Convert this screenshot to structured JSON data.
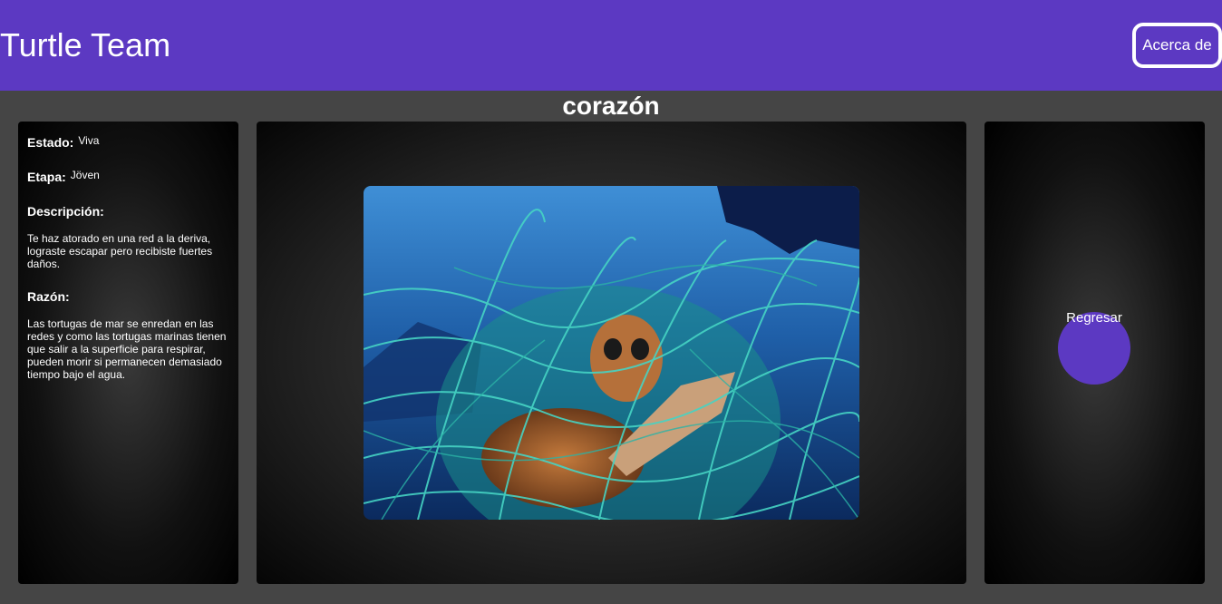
{
  "header": {
    "brand": "Turtle Team",
    "about_label": "Acerca de",
    "background": "#5c39c2"
  },
  "page": {
    "title": "corazón"
  },
  "info": {
    "estado_label": "Estado:",
    "estado_value": "Viva",
    "etapa_label": "Etapa:",
    "etapa_value": "Jöven",
    "descripcion_label": "Descripción:",
    "descripcion_text": "Te haz atorado en una red a la deriva, lograste escapar pero recibiste fuertes daños.",
    "razon_label": "Razón:",
    "razon_text": "Las tortugas de mar se enredan en las redes y como las tortugas marinas tienen que salir a la superficie para respirar, pueden morir si permanecen demasiado tiempo bajo el agua."
  },
  "media": {
    "image_subject": "sea-turtle-tangled-in-fishing-net-photo"
  },
  "actions": {
    "back_label": "Regresar",
    "accent": "#5c39c2"
  }
}
